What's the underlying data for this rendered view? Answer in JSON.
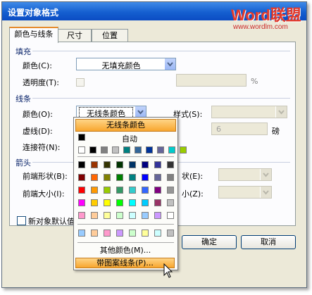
{
  "dialog": {
    "title": "设置对象格式",
    "logo": "Word联盟",
    "logo_url": "www.wordlm.com"
  },
  "tabs": [
    {
      "label": "颜色与线条",
      "active": true
    },
    {
      "label": "尺寸",
      "active": false
    },
    {
      "label": "位置",
      "active": false
    }
  ],
  "fill": {
    "section": "填充",
    "color_label": "颜色(C):",
    "color_value": "无填充颜色",
    "transparency_label": "透明度(T):",
    "transparency_unit": "%"
  },
  "line": {
    "section": "线条",
    "color_label": "颜色(O):",
    "color_value": "无线条颜色",
    "style_label": "样式(S):",
    "dash_label": "虚线(D):",
    "weight_value": "6",
    "weight_unit": "磅",
    "connector_label": "连接符(N):"
  },
  "arrows": {
    "section": "箭头",
    "begin_style_label": "前端形状(B):",
    "begin_size_label": "前端大小(I):",
    "end_style_label_partial": "状(E):",
    "end_size_label_partial": "小(Z):"
  },
  "default_checkbox_partial": "新对象默认值",
  "buttons": {
    "ok": "确定",
    "cancel": "取消"
  },
  "dropdown": {
    "highlight": "无线条颜色",
    "auto": "自动",
    "more_colors": "其他颜色(M)...",
    "pattern_lines": "带图案线条(P)...",
    "auto_color": "#000000",
    "recent_colors": [
      "#ffffff",
      "#000000",
      "#808080",
      "#c0c0c0",
      "#008080",
      "#336699",
      "#003399",
      "#666699",
      "#00cccc",
      "#99cc00"
    ],
    "palette": [
      [
        "#000000",
        "#993300",
        "#333300",
        "#003300",
        "#003366",
        "#000080",
        "#333399",
        "#333333"
      ],
      [
        "#800000",
        "#ff6600",
        "#808000",
        "#008000",
        "#008080",
        "#0000ff",
        "#666699",
        "#808080"
      ],
      [
        "#ff0000",
        "#ff9900",
        "#99cc00",
        "#339966",
        "#33cccc",
        "#3366ff",
        "#800080",
        "#969696"
      ],
      [
        "#ff00ff",
        "#ffcc00",
        "#ffff00",
        "#00ff00",
        "#00ffff",
        "#00ccff",
        "#993366",
        "#c0c0c0"
      ],
      [
        "#ff99cc",
        "#ffcc99",
        "#ffff99",
        "#ccffcc",
        "#ccffff",
        "#99ccff",
        "#cc99ff",
        "#ffffff"
      ]
    ],
    "extra_colors": [
      "#99ccff",
      "#ffcc99",
      "#ff99cc",
      "#cc99ff",
      "#ccffcc",
      "#ffff99",
      "#ccffff",
      "#c0c0c0"
    ]
  }
}
